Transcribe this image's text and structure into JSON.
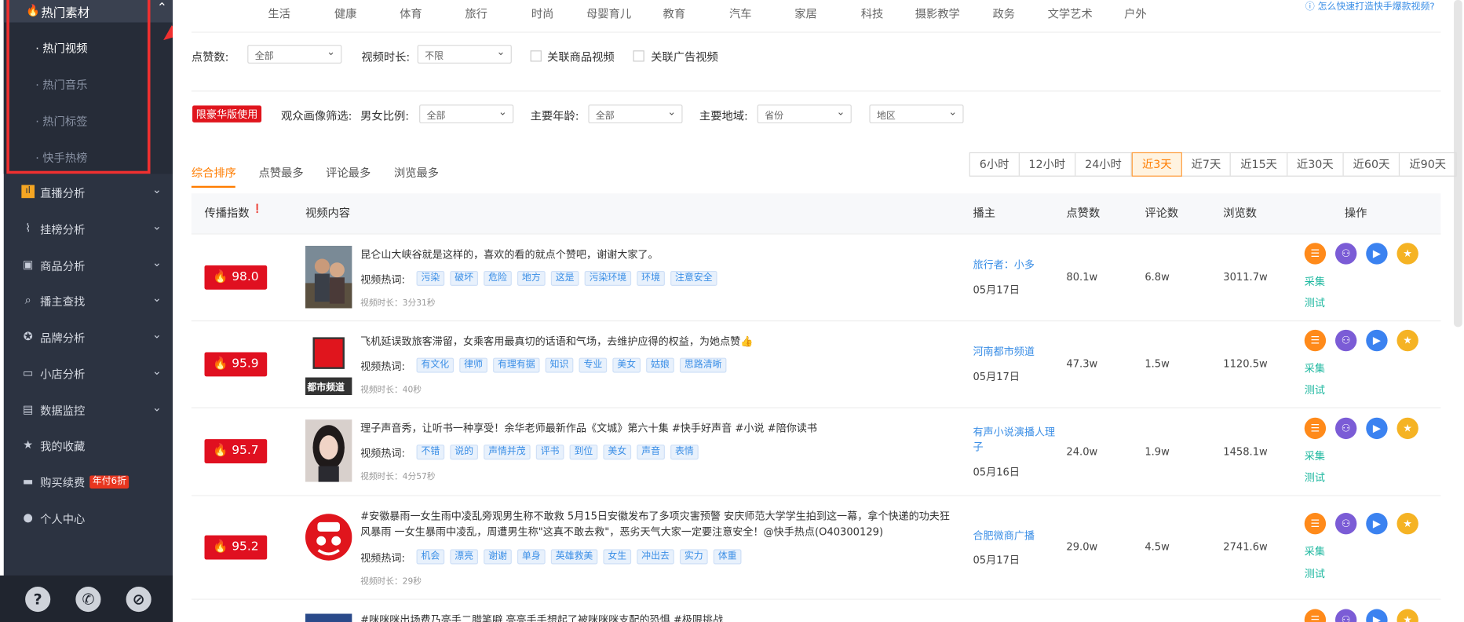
{
  "sidebar": {
    "group_title": "热门素材",
    "sub_items": [
      "· 热门视频",
      "· 热门音乐",
      "· 热门标签",
      "· 快手热榜"
    ],
    "items": [
      {
        "label": "直播分析",
        "icon": "bar-chart-icon",
        "chevron": "⌄"
      },
      {
        "label": "挂榜分析",
        "icon": "trend-icon",
        "chevron": "⌄"
      },
      {
        "label": "商品分析",
        "icon": "bag-icon",
        "chevron": "⌄"
      },
      {
        "label": "播主查找",
        "icon": "search-icon",
        "chevron": "⌄"
      },
      {
        "label": "品牌分析",
        "icon": "medal-icon",
        "chevron": "⌄"
      },
      {
        "label": "小店分析",
        "icon": "shop-icon",
        "chevron": "⌄"
      },
      {
        "label": "数据监控",
        "icon": "monitor-icon",
        "chevron": "⌄"
      },
      {
        "label": "我的收藏",
        "icon": "star-icon",
        "chevron": ""
      },
      {
        "label": "购买续费",
        "icon": "card-icon",
        "chevron": ""
      },
      {
        "label": "个人中心",
        "icon": "user-icon",
        "chevron": ""
      }
    ],
    "promo": "年付6折",
    "bottom_icons": [
      "?",
      "✆",
      "⊘"
    ]
  },
  "categories": [
    "生活",
    "健康",
    "体育",
    "旅行",
    "时尚",
    "母婴育儿",
    "教育",
    "汽车",
    "家居",
    "科技",
    "摄影教学",
    "政务",
    "文学艺术",
    "户外"
  ],
  "help_link": "ⓘ 怎么快速打造快手爆款视频?",
  "filters": {
    "likes_label": "点赞数:",
    "likes_value": "全部",
    "duration_label": "视频时长:",
    "duration_value": "不限",
    "check_goods": "关联商品视频",
    "check_ads": "关联广告视频",
    "vip_badge": "限豪华版使用",
    "audience_label": "观众画像筛选:",
    "gender_label": "男女比例:",
    "gender_value": "全部",
    "age_label": "主要年龄:",
    "age_value": "全部",
    "region_label": "主要地域:",
    "province_value": "省份",
    "area_value": "地区"
  },
  "sort_tabs": [
    "综合排序",
    "点赞最多",
    "评论最多",
    "浏览最多"
  ],
  "time_tabs": [
    "6小时",
    "12小时",
    "24小时",
    "近3天",
    "近7天",
    "近15天",
    "近30天",
    "近60天",
    "近90天"
  ],
  "time_active": "近3天",
  "table_headers": {
    "spread": "传播指数",
    "video": "视频内容",
    "anchor": "播主",
    "likes": "点赞数",
    "comments": "评论数",
    "views": "浏览数",
    "ops": "操作"
  },
  "row_labels": {
    "hot": "视频热词:",
    "collect": "采集",
    "test": "测试"
  },
  "rows": [
    {
      "score": "98.0",
      "title": "昆仑山大峡谷就是这样的，喜欢的看的就点个赞吧，谢谢大家了。",
      "tags": [
        "污染",
        "破坏",
        "危险",
        "地方",
        "这是",
        "污染环境",
        "环境",
        "注意安全"
      ],
      "duration": "视频时长：3分31秒",
      "anchor": "旅行者：小多",
      "date": "05月17日",
      "likes": "80.1w",
      "comments": "6.8w",
      "views": "3011.7w"
    },
    {
      "score": "95.9",
      "title": "飞机延误致旅客滞留，女乘客用最真切的话语和气场，去维护应得的权益，为她点赞👍",
      "tags": [
        "有文化",
        "律师",
        "有理有据",
        "知识",
        "专业",
        "美女",
        "姑娘",
        "思路清晰"
      ],
      "duration": "视频时长：40秒",
      "anchor": "河南都市频道",
      "date": "05月17日",
      "likes": "47.3w",
      "comments": "1.5w",
      "views": "1120.5w"
    },
    {
      "score": "95.7",
      "title": "理子声音秀，让听书一种享受！余华老师最新作品《文城》第六十集 #快手好声音 #小说 #陪你读书",
      "tags": [
        "不错",
        "说的",
        "声情并茂",
        "评书",
        "到位",
        "美女",
        "声音",
        "表情"
      ],
      "duration": "视频时长：4分57秒",
      "anchor": "有声小说演播人理子",
      "date": "05月16日",
      "likes": "24.0w",
      "comments": "1.9w",
      "views": "1458.1w"
    },
    {
      "score": "95.2",
      "title": "#安徽暴雨一女生雨中凌乱旁观男生称不敢救 5月15日安徽发布了多项灾害预警 安庆师范大学学生拍到这一幕，拿个快递的功夫狂风暴雨 一女生暴雨中凌乱，周遭男生称\"这真不敢去救\"，恶劣天气大家一定要注意安全！@快手热点(O40300129)",
      "tags": [
        "机会",
        "漂亮",
        "谢谢",
        "单身",
        "英雄救美",
        "女生",
        "冲出去",
        "实力",
        "体重"
      ],
      "duration": "视频时长：29秒",
      "anchor": "合肥微商广播",
      "date": "05月17日",
      "likes": "29.0w",
      "comments": "4.5w",
      "views": "2741.6w"
    }
  ],
  "partial_row_title": "#咪咪咪出场费乃亮手二腊笔噼 亮亮手手想起了被咪咪咪支配的恐惧 #极限挑战",
  "thumb_texts": {
    "row2": "都市频道"
  },
  "colors": {
    "accent": "#ff7d00",
    "score_red": "#e01020",
    "link": "#3a8ee6",
    "op_green": "#1fb8a0"
  }
}
